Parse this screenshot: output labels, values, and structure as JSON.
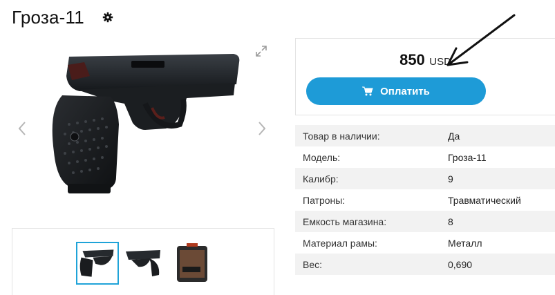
{
  "product": {
    "title": "Гроза-11"
  },
  "icons": {
    "settings": "gear-icon",
    "expand": "expand-icon",
    "prev": "chevron-left-icon",
    "next": "chevron-right-icon",
    "cart": "cart-icon"
  },
  "purchase": {
    "price": "850",
    "currency": "USD",
    "pay_label": "Оплатить",
    "accent_color": "#1e9bd7"
  },
  "specs": [
    {
      "label": "Товар в наличии:",
      "value": "Да"
    },
    {
      "label": "Модель:",
      "value": "Гроза-11"
    },
    {
      "label": "Калибр:",
      "value": "9"
    },
    {
      "label": "Патроны:",
      "value": "Травматический"
    },
    {
      "label": "Емкость магазина:",
      "value": "8"
    },
    {
      "label": "Материал рамы:",
      "value": "Металл"
    },
    {
      "label": "Вес:",
      "value": "0,690"
    }
  ],
  "gallery": {
    "thumbnail_count": 3,
    "selected_index": 0
  }
}
